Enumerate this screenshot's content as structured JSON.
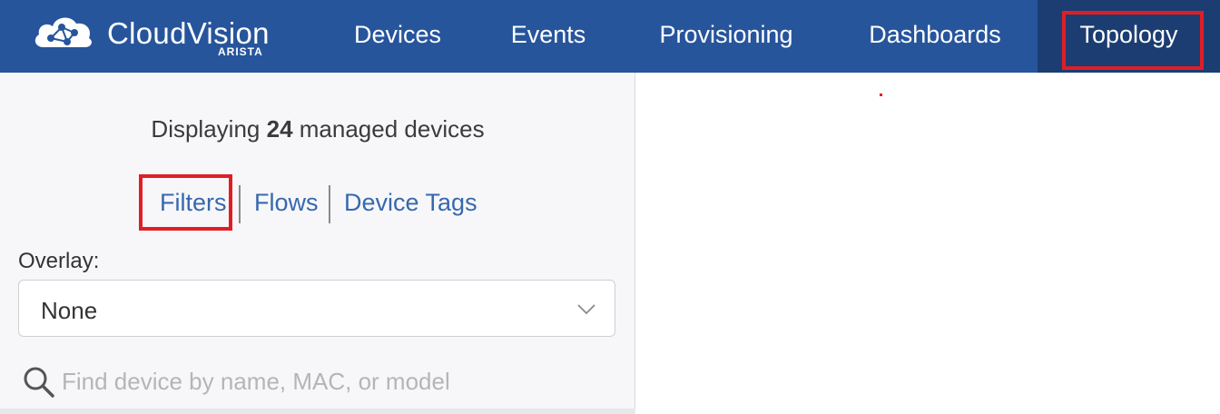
{
  "brand": {
    "name": "CloudVision",
    "vendor": "ARISTA",
    "icon": "cloud-network-icon"
  },
  "nav": {
    "items": [
      {
        "label": "Devices"
      },
      {
        "label": "Events"
      },
      {
        "label": "Provisioning"
      },
      {
        "label": "Dashboards"
      },
      {
        "label": "Topology",
        "active": true
      }
    ]
  },
  "sidebar": {
    "display_prefix": "Displaying",
    "device_count": "24",
    "display_suffix": "managed devices",
    "tabs": [
      {
        "label": "Filters",
        "highlighted": true
      },
      {
        "label": "Flows"
      },
      {
        "label": "Device Tags"
      }
    ],
    "overlay": {
      "label": "Overlay:",
      "value": "None",
      "icon": "chevron-down-icon"
    },
    "search": {
      "placeholder": "Find device by name, MAC, or model",
      "value": "",
      "icon": "search-icon"
    }
  },
  "colors": {
    "topbar": "#27559c",
    "active_tab": "#1b3d71",
    "highlight": "#e01e26",
    "link": "#3768ae"
  }
}
